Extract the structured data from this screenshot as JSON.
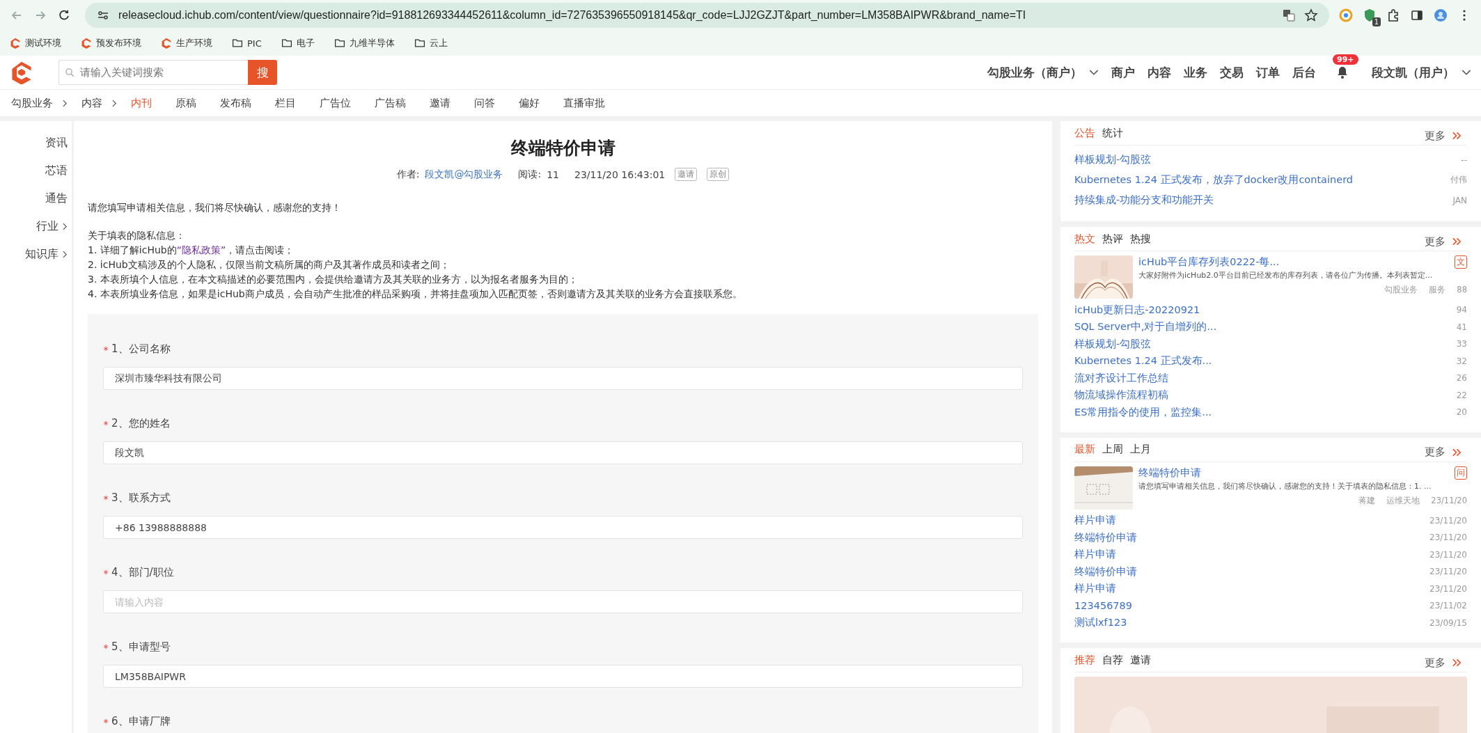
{
  "browser": {
    "url": "releasecloud.ichub.com/content/view/questionnaire?id=918812693344452611&column_id=727635396550918145&qr_code=LJJ2GZJT&part_number=LM358BAIPWR&brand_name=TI",
    "extension_badge": "1",
    "bookmarks": [
      {
        "label": "测试环境",
        "kind": "site"
      },
      {
        "label": "预发布环境",
        "kind": "site"
      },
      {
        "label": "生产环境",
        "kind": "site"
      },
      {
        "label": "PIC",
        "kind": "folder"
      },
      {
        "label": "电子",
        "kind": "folder"
      },
      {
        "label": "九维半导体",
        "kind": "folder"
      },
      {
        "label": "云上",
        "kind": "folder"
      }
    ]
  },
  "header": {
    "search": {
      "placeholder": "请输入关键词搜索",
      "button": "搜"
    },
    "business_switch": "勾股业务（商户）",
    "business_switch_expanded": false,
    "nav_links": [
      "商户",
      "内容",
      "业务",
      "交易",
      "订单",
      "后台"
    ],
    "notification_badge": "99+",
    "user_menu": "段文凯（用户）",
    "user_menu_expanded": false
  },
  "subnav": {
    "breadcrumb": [
      "勾股业务",
      "内容"
    ],
    "tabs": [
      {
        "label": "内刊",
        "selected": true
      },
      {
        "label": "原稿",
        "selected": false
      },
      {
        "label": "发布稿",
        "selected": false
      },
      {
        "label": "栏目",
        "selected": false
      },
      {
        "label": "广告位",
        "selected": false
      },
      {
        "label": "广告稿",
        "selected": false
      },
      {
        "label": "邀请",
        "selected": false
      },
      {
        "label": "问答",
        "selected": false
      },
      {
        "label": "偏好",
        "selected": false
      },
      {
        "label": "直播审批",
        "selected": false
      }
    ]
  },
  "sidebar": {
    "items": [
      {
        "label": "资讯",
        "has_children": false
      },
      {
        "label": "芯语",
        "has_children": false
      },
      {
        "label": "通告",
        "has_children": false
      },
      {
        "label": "行业",
        "has_children": true
      },
      {
        "label": "知识库",
        "has_children": true
      }
    ]
  },
  "article": {
    "title": "终端特价申请",
    "author_label": "作者:",
    "author": "段文凯@勾股业务",
    "reads_label": "阅读:",
    "reads": "11",
    "date": "23/11/20 16:43:01",
    "tags": [
      "邀请",
      "原创"
    ],
    "intro": "请您填写申请相关信息，我们将尽快确认，感谢您的支持！",
    "privacy_heading": "关于填表的隐私信息：",
    "privacy_items": [
      {
        "text": "1. 详细了解icHub的",
        "link": "“隐私政策”",
        "after": "，请点击阅读；"
      },
      {
        "text": "2. icHub文稿涉及的个人隐私，仅限当前文稿所属的商户及其著作成员和读者之间；"
      },
      {
        "text": "3. 本表所填个人信息，在本文稿描述的必要范围内，会提供给邀请方及其关联的业务方，以为报名者服务为目的；"
      },
      {
        "text": "4. 本表所填业务信息，如果是icHub商户成员，会自动产生批准的样品采购项，并将挂盘项加入匹配页签，否则邀请方及其关联的业务方会直接联系您。"
      }
    ]
  },
  "form": {
    "questions": [
      {
        "label": "1、公司名称",
        "required": true,
        "value": "深圳市臻华科技有限公司"
      },
      {
        "label": "2、您的姓名",
        "required": true,
        "value": "段文凯"
      },
      {
        "label": "3、联系方式",
        "required": true,
        "value": "+86 13988888888"
      },
      {
        "label": "4、部门/职位",
        "required": true,
        "placeholder": "请输入内容"
      },
      {
        "label": "5、申请型号",
        "required": true,
        "value": "LM358BAIPWR"
      },
      {
        "label": "6、申请厂牌",
        "required": true
      }
    ]
  },
  "widgets": [
    {
      "tabs": [
        {
          "label": "公告",
          "selected": true
        },
        {
          "label": "统计",
          "selected": false
        }
      ],
      "more": "更多",
      "rows": [
        {
          "title": "样板规划-勾股弦",
          "meta": "--"
        },
        {
          "title": "Kubernetes 1.24 正式发布，放弃了docker改用containerd",
          "meta": "付伟"
        },
        {
          "title": "持续集成-功能分支和功能开关",
          "meta": "JAN"
        }
      ]
    },
    {
      "tabs": [
        {
          "label": "热文",
          "selected": true
        },
        {
          "label": "热评",
          "selected": false
        },
        {
          "label": "热搜",
          "selected": false
        }
      ],
      "more": "更多",
      "featured": {
        "kind": "book",
        "title": "icHub平台库存列表0222-每...",
        "summary": "大家好附件为icHub2.0平台目前已经发布的库存列表，请各位广为传播。本列表暂定...",
        "meta": [
          "勾股业务",
          "服务",
          "88"
        ],
        "badge": "文"
      },
      "rows": [
        {
          "title": "icHub更新日志-20220921",
          "meta": "94"
        },
        {
          "title": "SQL Server中,对于自增列的...",
          "meta": "41"
        },
        {
          "title": "样板规划-勾股弦",
          "meta": "33"
        },
        {
          "title": "Kubernetes 1.24 正式发布...",
          "meta": "32"
        },
        {
          "title": "流对齐设计工作总结",
          "meta": "26"
        },
        {
          "title": "物流域操作流程初稿",
          "meta": "22"
        },
        {
          "title": "ES常用指令的使用，监控集...",
          "meta": "20"
        }
      ]
    },
    {
      "tabs": [
        {
          "label": "最新",
          "selected": true
        },
        {
          "label": "上周",
          "selected": false
        },
        {
          "label": "上月",
          "selected": false
        }
      ],
      "more": "更多",
      "featured": {
        "kind": "paper",
        "title": "终端特价申请",
        "summary": "请您填写申请相关信息，我们将尽快确认，感谢您的支持！关于填表的隐私信息：1. ...",
        "meta": [
          "蒋建",
          "运维天地",
          "23/11/20"
        ],
        "badge": "问"
      },
      "rows": [
        {
          "title": "样片申请",
          "meta": "23/11/20"
        },
        {
          "title": "终端特价申请",
          "meta": "23/11/20"
        },
        {
          "title": "样片申请",
          "meta": "23/11/20"
        },
        {
          "title": "终端特价申请",
          "meta": "23/11/20"
        },
        {
          "title": "样片申请",
          "meta": "23/11/20"
        },
        {
          "title": "123456789",
          "meta": "23/11/02"
        },
        {
          "title": "测试lxf123",
          "meta": "23/09/15"
        }
      ]
    },
    {
      "tabs": [
        {
          "label": "推荐",
          "selected": true
        },
        {
          "label": "自荐",
          "selected": false
        },
        {
          "label": "邀请",
          "selected": false
        }
      ],
      "more": "更多",
      "banner": {
        "kind": "picture"
      }
    }
  ]
}
